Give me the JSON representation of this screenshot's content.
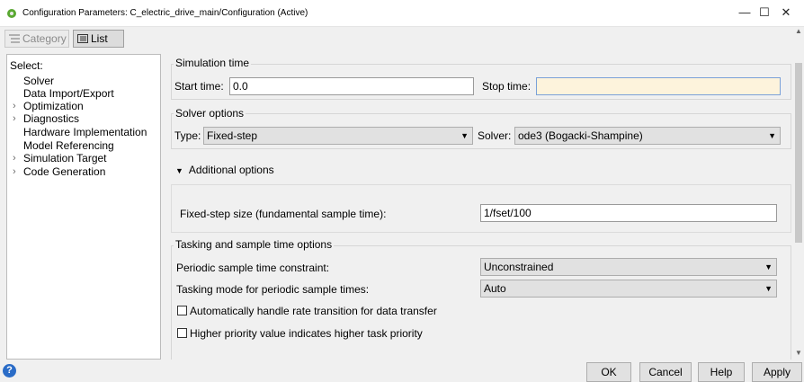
{
  "window": {
    "title": "Configuration Parameters: C_electric_drive_main/Configuration (Active)",
    "minimize": "—",
    "maximize": "☐",
    "close": "✕"
  },
  "toolbar": {
    "category_label": "Category",
    "list_label": "List"
  },
  "sidebar": {
    "select_label": "Select:",
    "items": [
      {
        "label": "Solver",
        "expandable": false
      },
      {
        "label": "Data Import/Export",
        "expandable": false
      },
      {
        "label": "Optimization",
        "expandable": true
      },
      {
        "label": "Diagnostics",
        "expandable": true
      },
      {
        "label": "Hardware Implementation",
        "expandable": false
      },
      {
        "label": "Model Referencing",
        "expandable": false
      },
      {
        "label": "Simulation Target",
        "expandable": true
      },
      {
        "label": "Code Generation",
        "expandable": true
      }
    ]
  },
  "simulation_time": {
    "group_label": "Simulation time",
    "start_label": "Start time:",
    "start_value": "0.0",
    "stop_label": "Stop time:",
    "stop_value": ""
  },
  "solver_options": {
    "group_label": "Solver options",
    "type_label": "Type:",
    "type_value": "Fixed-step",
    "solver_label": "Solver:",
    "solver_value": "ode3 (Bogacki-Shampine)"
  },
  "additional_options": {
    "toggle_label": "Additional options",
    "fixed_step_label": "Fixed-step size (fundamental sample time):",
    "fixed_step_value": "1/fset/100"
  },
  "tasking": {
    "group_label": "Tasking and sample time options",
    "periodic_label": "Periodic sample time constraint:",
    "periodic_value": "Unconstrained",
    "tasking_mode_label": "Tasking mode for periodic sample times:",
    "tasking_mode_value": "Auto",
    "auto_rate_label": "Automatically handle rate transition for data transfer",
    "priority_label": "Higher priority value indicates higher task priority"
  },
  "buttons": {
    "ok": "OK",
    "cancel": "Cancel",
    "help": "Help",
    "apply": "Apply"
  }
}
